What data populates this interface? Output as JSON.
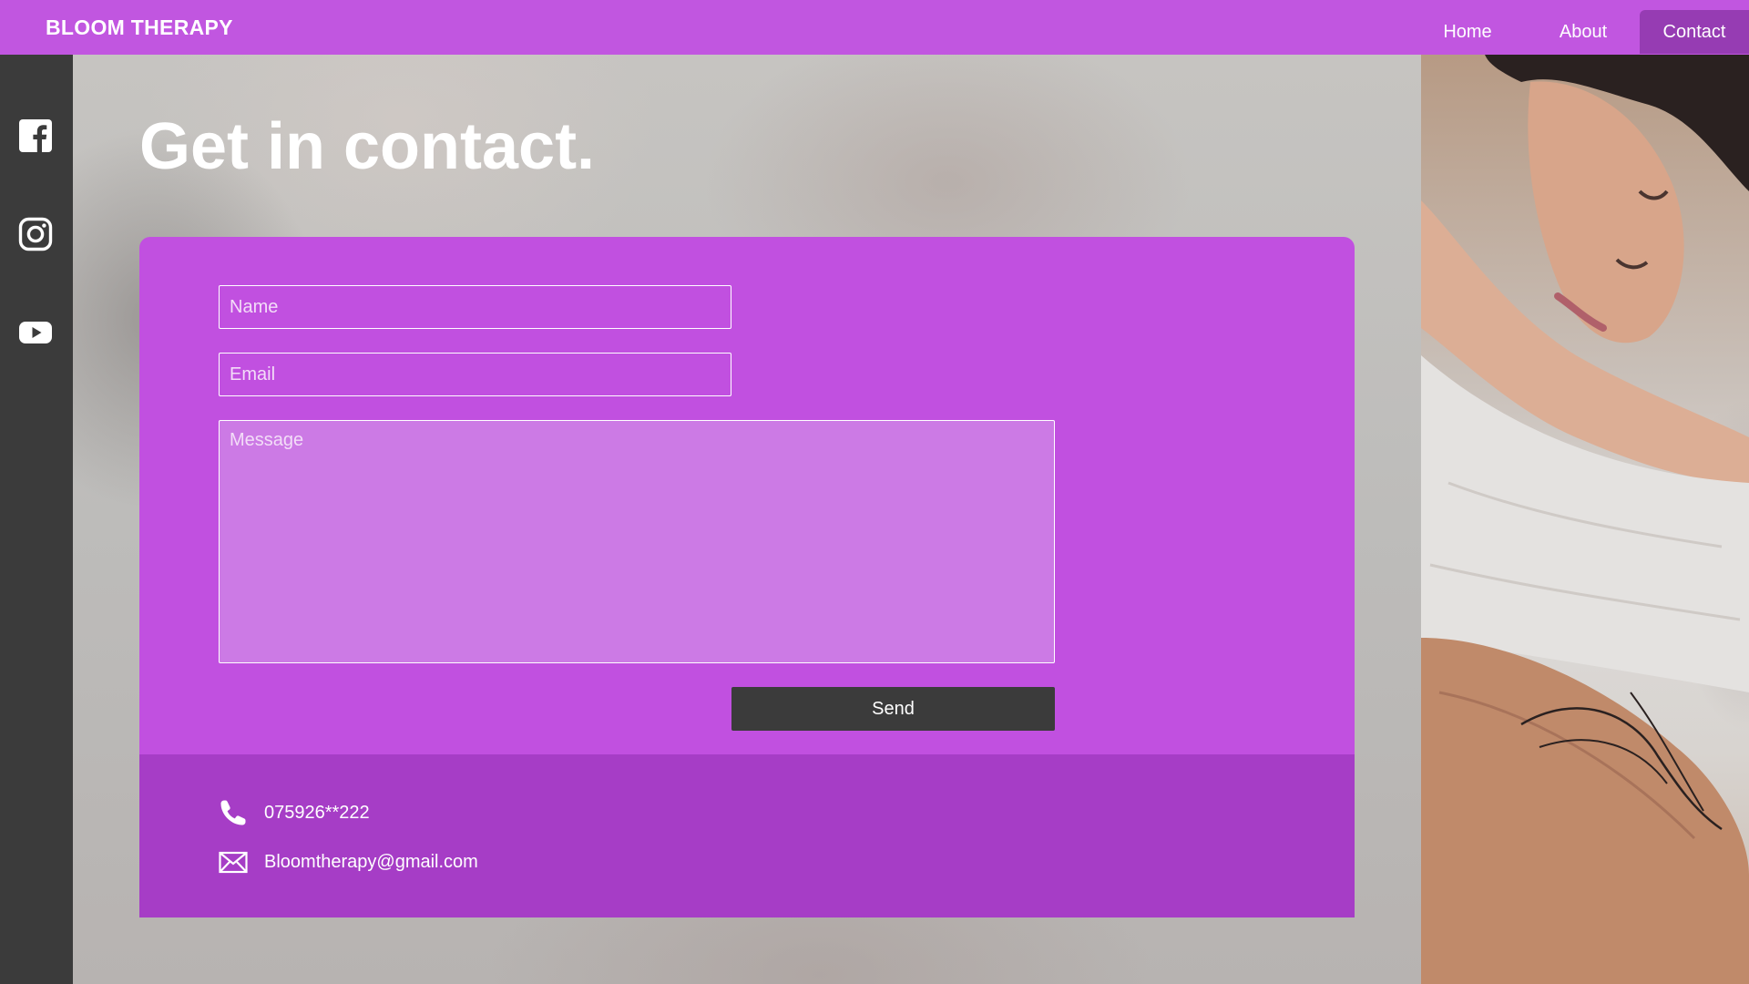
{
  "header": {
    "brand": "BLOOM THERAPY",
    "nav": [
      {
        "label": "Home"
      },
      {
        "label": "About"
      },
      {
        "label": "Contact",
        "active": true
      }
    ]
  },
  "social": [
    {
      "icon": "facebook-icon"
    },
    {
      "icon": "instagram-icon"
    },
    {
      "icon": "youtube-icon"
    }
  ],
  "main": {
    "title": "Get in contact.",
    "form": {
      "name_placeholder": "Name",
      "name_value": "",
      "email_placeholder": "Email",
      "email_value": "",
      "message_placeholder": "Message",
      "message_value": "",
      "send_label": "Send"
    },
    "contact_info": {
      "phone": "075926**222",
      "email": "Bloomtherapy@gmail.com"
    }
  },
  "colors": {
    "brand_purple": "#c156e0",
    "active_nav": "#963cb3",
    "info_band": "#a63dc6",
    "dark": "#3b3b3b"
  }
}
